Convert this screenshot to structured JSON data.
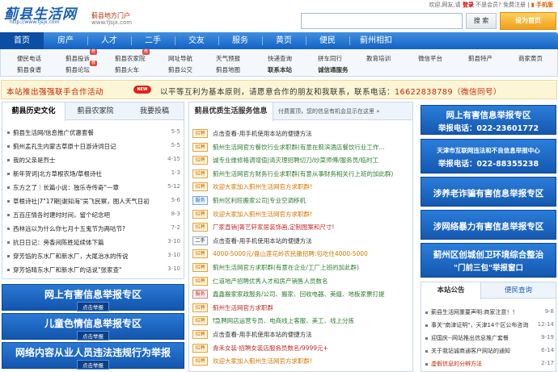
{
  "header": {
    "logo": "蓟县生活网",
    "logo_url": "http://www.fjsjx.com",
    "portal_name": "蓟县地方门户",
    "portal_url": "www.fjsjx.com",
    "topbar": {
      "welcome": "欢迎,网友,请",
      "login": "登录",
      "register_text": "不是会员?",
      "register": "免费注册",
      "mobile": "手机版"
    },
    "search_button": "搜 索",
    "home_button": "设为首页"
  },
  "nav": [
    "首页",
    "房产",
    "人才",
    "二手",
    "交友",
    "服务",
    "黄页",
    "便民",
    "蓟州相扣"
  ],
  "subnav": {
    "row1": [
      {
        "label": "便民电话"
      },
      {
        "label": "蓟县投诉",
        "badge": "荐"
      },
      {
        "label": "蓟县农家院",
        "badge": "荐"
      },
      {
        "label": "网址导航"
      },
      {
        "label": "天气预报"
      },
      {
        "label": "快递查询"
      },
      {
        "label": "拼车同行"
      },
      {
        "label": "教育培训"
      },
      {
        "label": "微信平台"
      },
      {
        "label": "蓟县特产"
      },
      {
        "label": "商家黄页"
      }
    ],
    "row2": [
      {
        "label": "蓟县食谱"
      },
      {
        "label": "蓟县论坛",
        "badge": "荐"
      },
      {
        "label": "蓟县火车"
      },
      {
        "label": "蓟县公交"
      },
      {
        "label": "蓟县地图"
      },
      {
        "label": "联系本站"
      },
      {
        "label": "诚信通服务"
      }
    ]
  },
  "notice": {
    "left": "本站推出强强联手合作活动",
    "badge": "NEW",
    "right": "以平等互利为基本原则，请愿意合作的朋友和我联系，联系电话：",
    "phone": "16622838789（微信同号）"
  },
  "left_panel": {
    "tabs": [
      "蓟县历史文化",
      "蓟县农家院",
      "我要投稿"
    ],
    "items": [
      {
        "title": "蓟县生活网/信息推广优惠套餐",
        "date": "5-5"
      },
      {
        "title": "蓟州孟孔生内蒙古草原十日游诗词日记",
        "date": "5-5"
      },
      {
        "title": "我的父亲是烈士",
        "date": "4-15"
      },
      {
        "title": "新年贺词|北方草根农场/草根诗社",
        "date": "1-3"
      },
      {
        "title": "东方之了｜长篇小说：独乐寺传奇\"一章",
        "date": "5-12"
      },
      {
        "title": "草根诗社|7\"17期|谢知海\"吴飞民察，图人天气日初",
        "date": "5-6"
      },
      {
        "title": "五百庄情各时建时时间，留个纪念吧",
        "date": "8-3"
      },
      {
        "title": "西林远以为什么你七月十五鬼节为两咕节?",
        "date": "7-2"
      },
      {
        "title": "抗日日记：旁香间陈胜延续体下篇",
        "date": "3-10"
      },
      {
        "title": "穿芳馅的东水厂和新水厂，大尾治水的传说",
        "date": "3-10"
      },
      {
        "title": "穿芳馅晴东水厂和新水厂的话说\"张家查\"",
        "date": "3-10"
      }
    ],
    "banners": [
      {
        "title": "网上有害信息举报专区",
        "sub": "点击举报"
      },
      {
        "title": "儿童色情信息举报专区",
        "sub": "点击举报"
      },
      {
        "title": "网络内容从业人员违法违规行为举报",
        "sub": "点击举报"
      }
    ]
  },
  "middle_panel": {
    "title": "蓟县优质生活服务信息",
    "hint": "付费置顶，您的信息有机会显示在这里 »",
    "items": [
      {
        "tag": "招聘",
        "style": "z",
        "text": "点击查看-用手机使用本站的便捷方法",
        "color": "#333"
      },
      {
        "tag": "招聘",
        "style": "z",
        "text": "蓟州生活网官方餐饮行业求职群(有意在蓟滨酒店餐饮行业工作...",
        "color": "#2e7d32"
      },
      {
        "tag": "招聘",
        "style": "z",
        "text": "诚专业维修格调增值|清灭理招聘切刀/炒菜师傅/服务员/临时工",
        "color": "#2e7d32"
      },
      {
        "tag": "招聘",
        "style": "z",
        "text": "蓟州生活网官方财务行业求职群(有意从事财务相关行上班的加此群)",
        "color": "#2e7d32"
      },
      {
        "tag": "招聘",
        "style": "z",
        "text": "欢迎大家加入蓟州生活网官方求职群!",
        "color": "#d27700"
      },
      {
        "tag": "服务",
        "style": "b",
        "text": "蓟州区利旺搬家公司|专业空调移机",
        "color": "#2e7d32"
      },
      {
        "tag": "招聘",
        "style": "z",
        "text": "欢迎大家加入蓟州生活网官方求职群!",
        "color": "#d27700"
      },
      {
        "tag": "招聘",
        "style": "z",
        "text": "厂家直销|菁艺轩家居装饰画,定制图案和尺寸!",
        "color": "#c02a2a"
      },
      {
        "tag": "二手",
        "style": "q",
        "text": "点击查看-用手机使用本站的便捷方法",
        "color": "#333"
      },
      {
        "tag": "招聘",
        "style": "z",
        "text": "4000-5000元/盘山莲花岭农民撒招聘:包吃住4000-5000",
        "color": "#d27700"
      },
      {
        "tag": "招聘",
        "style": "z",
        "text": "蓟州生活网官方求职群(有意在企业/工厂上班的加此群)",
        "color": "#2e7d32"
      },
      {
        "tag": "招聘",
        "style": "z",
        "text": "仁道地产招聘优秀人才和房产销售人员数名",
        "color": "#2e7d32"
      },
      {
        "tag": "服务",
        "style": "r",
        "text": "鑫鑫搬家家政服务/公司、搬家、回收电器、美缝、地板家票打提",
        "color": "#2e7d32"
      },
      {
        "tag": "招聘",
        "style": "z",
        "text": "蓟州生活网官方求职群",
        "color": "#c02a2a"
      },
      {
        "tag": "招聘",
        "style": "z",
        "text": "f急聘网店运营专员、电商线上客服、美工、线上分拣",
        "color": "#2e7d32"
      },
      {
        "tag": "招聘",
        "style": "z",
        "text": "点击查看-用手机使用本站的便捷方法",
        "color": "#333"
      },
      {
        "tag": "招聘",
        "style": "z",
        "text": "青禾女装·招聘女装店服务员数名/9999元+",
        "color": "#c02a2a"
      },
      {
        "tag": "招聘",
        "style": "z",
        "text": "欢迎大家加入蓟州生活网官方求职群!",
        "color": "#d27700"
      }
    ]
  },
  "right_panel": {
    "banners": [
      {
        "line1": "网上有害信息举报专区",
        "line2": "举报电话：022-23601772"
      },
      {
        "line1": "天津市互联网违法和不良信息举报中心",
        "line2": "举报电话：022-88355238",
        "small": true
      },
      {
        "line1": "涉养老诈骗有害信息举报专区"
      },
      {
        "line1": "涉网络暴力有害信息举报专区"
      },
      {
        "line1": "蓟州区创城创卫环境综合整治",
        "line2": "\"门前三包\"举报窗口"
      }
    ],
    "tabs": [
      "本站公告",
      "便民查询"
    ],
    "items": [
      {
        "title": "蓟县生活网重要声明:商家注意！！",
        "date": "9-8"
      },
      {
        "title": "事关\"南津证明\"，天津14个区公布咨询",
        "date": "12-14"
      },
      {
        "title": "迎国庆--网站推出信息推广套餐",
        "date": "9-19"
      },
      {
        "title": "关于我站诚商通客户网站的通知",
        "date": "6-14"
      },
      {
        "title": "虚假信息的分辨方法",
        "date": "2-17"
      }
    ]
  }
}
